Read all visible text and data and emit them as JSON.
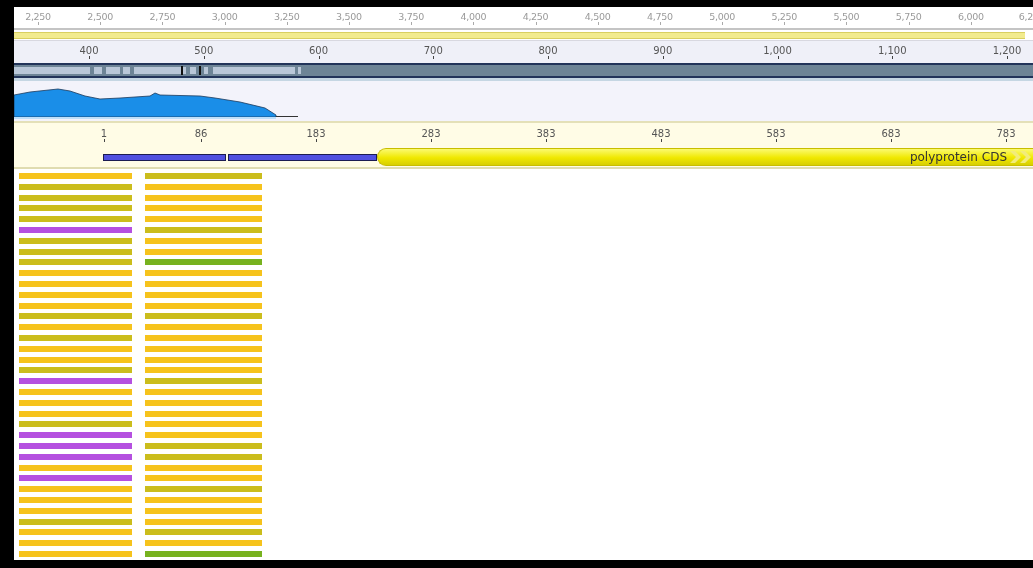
{
  "overview_ruler": {
    "ticks": [
      "2,250",
      "2,500",
      "2,750",
      "3,000",
      "3,250",
      "3,500",
      "3,750",
      "4,000",
      "4,250",
      "4,500",
      "4,750",
      "5,000",
      "5,250",
      "5,500",
      "5,750",
      "6,000",
      "6,2"
    ]
  },
  "alignment_ruler": {
    "ticks": [
      "400",
      "500",
      "600",
      "700",
      "800",
      "900",
      "1,000",
      "1,100",
      "1,200"
    ]
  },
  "annotation_track": {
    "ruler": {
      "ticks": [
        "1",
        "86",
        "183",
        "283",
        "383",
        "483",
        "583",
        "683",
        "783"
      ]
    },
    "features": [
      {
        "kind": "region"
      },
      {
        "kind": "region"
      },
      {
        "kind": "cds",
        "label": "polyprotein CDS"
      }
    ]
  },
  "read_rows": [
    {
      "reads": [
        {
          "color": "#f6c31c"
        },
        {
          "color": "#cbbd1c"
        }
      ]
    },
    {
      "reads": [
        {
          "color": "#cbbd1c"
        },
        {
          "color": "#f6c31c"
        }
      ]
    },
    {
      "reads": [
        {
          "color": "#cbbd1c"
        },
        {
          "color": "#f6c31c"
        }
      ]
    },
    {
      "reads": [
        {
          "color": "#cbbd1c"
        },
        {
          "color": "#f6c31c"
        }
      ]
    },
    {
      "reads": [
        {
          "color": "#cbbd1c"
        },
        {
          "color": "#f6c31c"
        }
      ]
    },
    {
      "reads": [
        {
          "color": "#b550e0"
        },
        {
          "color": "#cbbd1c"
        }
      ]
    },
    {
      "reads": [
        {
          "color": "#cbbd1c"
        },
        {
          "color": "#f6c31c"
        }
      ]
    },
    {
      "reads": [
        {
          "color": "#cbbd1c"
        },
        {
          "color": "#f6c31c"
        }
      ]
    },
    {
      "reads": [
        {
          "color": "#cbbd1c"
        },
        {
          "color": "#77b21f"
        }
      ]
    },
    {
      "reads": [
        {
          "color": "#f6c31c"
        },
        {
          "color": "#f6c31c"
        }
      ]
    },
    {
      "reads": [
        {
          "color": "#f6c31c"
        },
        {
          "color": "#f6c31c"
        }
      ]
    },
    {
      "reads": [
        {
          "color": "#f6c31c"
        },
        {
          "color": "#f6c31c"
        }
      ]
    },
    {
      "reads": [
        {
          "color": "#f6c31c"
        },
        {
          "color": "#f6c31c"
        }
      ]
    },
    {
      "reads": [
        {
          "color": "#cbbd1c"
        },
        {
          "color": "#cbbd1c"
        }
      ]
    },
    {
      "reads": [
        {
          "color": "#f6c31c"
        },
        {
          "color": "#f6c31c"
        }
      ]
    },
    {
      "reads": [
        {
          "color": "#cbbd1c"
        },
        {
          "color": "#f6c31c"
        }
      ]
    },
    {
      "reads": [
        {
          "color": "#f6c31c"
        },
        {
          "color": "#f6c31c"
        }
      ]
    },
    {
      "reads": [
        {
          "color": "#f6c31c"
        },
        {
          "color": "#f6c31c"
        }
      ]
    },
    {
      "reads": [
        {
          "color": "#cbbd1c"
        },
        {
          "color": "#f6c31c"
        }
      ]
    },
    {
      "reads": [
        {
          "color": "#b550e0"
        },
        {
          "color": "#cbbd1c"
        }
      ]
    },
    {
      "reads": [
        {
          "color": "#f6c31c"
        },
        {
          "color": "#f6c31c"
        }
      ]
    },
    {
      "reads": [
        {
          "color": "#f6c31c"
        },
        {
          "color": "#f6c31c"
        }
      ]
    },
    {
      "reads": [
        {
          "color": "#f6c31c"
        },
        {
          "color": "#f6c31c"
        }
      ]
    },
    {
      "reads": [
        {
          "color": "#cbbd1c"
        },
        {
          "color": "#f6c31c"
        }
      ]
    },
    {
      "reads": [
        {
          "color": "#b550e0"
        },
        {
          "color": "#f6c31c"
        }
      ]
    },
    {
      "reads": [
        {
          "color": "#b550e0"
        },
        {
          "color": "#cbbd1c"
        }
      ]
    },
    {
      "reads": [
        {
          "color": "#b550e0"
        },
        {
          "color": "#cbbd1c"
        }
      ]
    },
    {
      "reads": [
        {
          "color": "#f6c31c"
        },
        {
          "color": "#f6c31c"
        }
      ]
    },
    {
      "reads": [
        {
          "color": "#b550e0"
        },
        {
          "color": "#f6c31c"
        }
      ]
    },
    {
      "reads": [
        {
          "color": "#f6c31c"
        },
        {
          "color": "#cbbd1c"
        }
      ]
    },
    {
      "reads": [
        {
          "color": "#f6c31c"
        },
        {
          "color": "#f6c31c"
        }
      ]
    },
    {
      "reads": [
        {
          "color": "#f6c31c"
        },
        {
          "color": "#f6c31c"
        }
      ]
    },
    {
      "reads": [
        {
          "color": "#cbbd1c"
        },
        {
          "color": "#f6c31c"
        }
      ]
    },
    {
      "reads": [
        {
          "color": "#f6c31c"
        },
        {
          "color": "#cbbd1c"
        }
      ]
    },
    {
      "reads": [
        {
          "color": "#f6c31c"
        },
        {
          "color": "#f6c31c"
        }
      ]
    },
    {
      "reads": [
        {
          "color": "#f6c31c"
        },
        {
          "color": "#77b21f"
        }
      ]
    }
  ]
}
